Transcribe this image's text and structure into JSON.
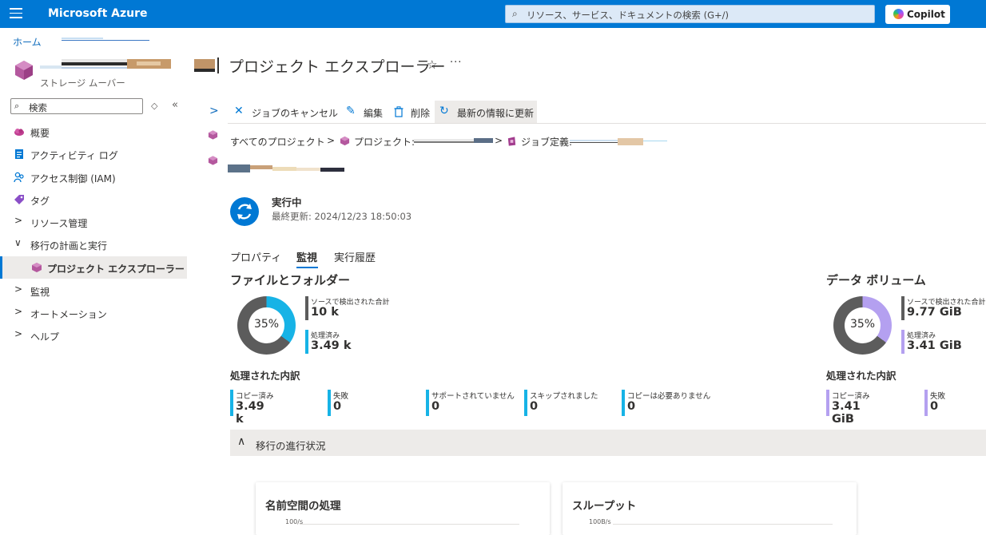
{
  "topbar": {
    "brand": "Microsoft Azure",
    "search_placeholder": "リソース、サービス、ドキュメントの検索 (G+/)",
    "copilot_label": "Copilot"
  },
  "breadcrumb": {
    "home": "ホーム"
  },
  "resource": {
    "subtitle": "ストレージ ムーバー"
  },
  "page": {
    "title": "プロジェクト エクスプローラー"
  },
  "sidebar": {
    "search_placeholder": "検索",
    "items": [
      {
        "label": "概要",
        "icon": "cloud-icon"
      },
      {
        "label": "アクティビティ ログ",
        "icon": "log-icon"
      },
      {
        "label": "アクセス制御 (IAM)",
        "icon": "people-icon"
      },
      {
        "label": "タグ",
        "icon": "tag-icon"
      },
      {
        "label": "リソース管理",
        "icon": "chevron-right-icon"
      },
      {
        "label": "移行の計画と実行",
        "icon": "chevron-down-icon"
      },
      {
        "label": "プロジェクト エクスプローラー",
        "icon": "cube-icon"
      },
      {
        "label": "監視",
        "icon": "chevron-right-icon"
      },
      {
        "label": "オートメーション",
        "icon": "chevron-right-icon"
      },
      {
        "label": "ヘルプ",
        "icon": "chevron-right-icon"
      }
    ]
  },
  "toolbar": {
    "cancel_job": "ジョブのキャンセル",
    "edit": "編集",
    "delete": "削除",
    "refresh": "最新の情報に更新"
  },
  "project_breadcrumb": {
    "all_projects": "すべてのプロジェクト",
    "project": "プロジェクト:",
    "job_definition": "ジョブ定義:"
  },
  "status": {
    "title": "実行中",
    "last_updated": "最終更新: 2024/12/23 18:50:03"
  },
  "tabs": [
    "プロパティ",
    "監視",
    "実行履歴"
  ],
  "files": {
    "title": "ファイルとフォルダー",
    "percent": "35%",
    "percent_value": 35,
    "detected_label": "ソースで検出された合計",
    "detected_value": "10 k",
    "processed_label": "処理済み",
    "processed_value": "3.49 k",
    "breakdown_title": "処理された内訳",
    "breakdown": [
      {
        "label": "コピー済み",
        "value": "3.49 k"
      },
      {
        "label": "失敗",
        "value": "0"
      },
      {
        "label": "サポートされていません",
        "value": "0"
      },
      {
        "label": "スキップされました",
        "value": "0"
      },
      {
        "label": "コピーは必要ありません",
        "value": "0"
      }
    ]
  },
  "volume": {
    "title": "データ ボリューム",
    "percent": "35%",
    "percent_value": 35,
    "detected_label": "ソースで検出された合計",
    "detected_value": "9.77 GiB",
    "processed_label": "処理済み",
    "processed_value": "3.41 GiB",
    "breakdown_title": "処理された内訳",
    "breakdown": [
      {
        "label": "コピー済み",
        "value": "3.41 GiB"
      },
      {
        "label": "失敗",
        "value": "0"
      }
    ]
  },
  "progress": {
    "title": "移行の進行状況",
    "cards": [
      {
        "title": "名前空間の処理",
        "axis_label": "100/s"
      },
      {
        "title": "スループット",
        "axis_label": "100B/s"
      }
    ]
  },
  "colors": {
    "accent": "#0078d4",
    "files_processed": "#17b3e6",
    "volume_processed": "#b4a0f0",
    "remaining": "#5c5c5c"
  }
}
